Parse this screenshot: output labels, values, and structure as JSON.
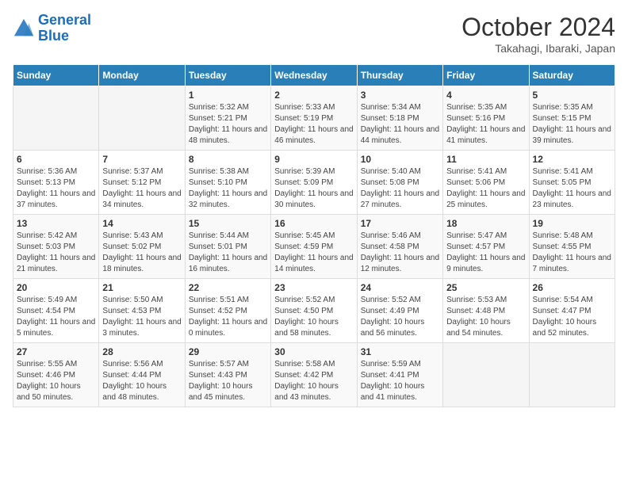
{
  "header": {
    "logo_line1": "General",
    "logo_line2": "Blue",
    "title": "October 2024",
    "subtitle": "Takahagi, Ibaraki, Japan"
  },
  "days_of_week": [
    "Sunday",
    "Monday",
    "Tuesday",
    "Wednesday",
    "Thursday",
    "Friday",
    "Saturday"
  ],
  "weeks": [
    [
      {
        "day": "",
        "sunrise": "",
        "sunset": "",
        "daylight": ""
      },
      {
        "day": "",
        "sunrise": "",
        "sunset": "",
        "daylight": ""
      },
      {
        "day": "1",
        "sunrise": "Sunrise: 5:32 AM",
        "sunset": "Sunset: 5:21 PM",
        "daylight": "Daylight: 11 hours and 48 minutes."
      },
      {
        "day": "2",
        "sunrise": "Sunrise: 5:33 AM",
        "sunset": "Sunset: 5:19 PM",
        "daylight": "Daylight: 11 hours and 46 minutes."
      },
      {
        "day": "3",
        "sunrise": "Sunrise: 5:34 AM",
        "sunset": "Sunset: 5:18 PM",
        "daylight": "Daylight: 11 hours and 44 minutes."
      },
      {
        "day": "4",
        "sunrise": "Sunrise: 5:35 AM",
        "sunset": "Sunset: 5:16 PM",
        "daylight": "Daylight: 11 hours and 41 minutes."
      },
      {
        "day": "5",
        "sunrise": "Sunrise: 5:35 AM",
        "sunset": "Sunset: 5:15 PM",
        "daylight": "Daylight: 11 hours and 39 minutes."
      }
    ],
    [
      {
        "day": "6",
        "sunrise": "Sunrise: 5:36 AM",
        "sunset": "Sunset: 5:13 PM",
        "daylight": "Daylight: 11 hours and 37 minutes."
      },
      {
        "day": "7",
        "sunrise": "Sunrise: 5:37 AM",
        "sunset": "Sunset: 5:12 PM",
        "daylight": "Daylight: 11 hours and 34 minutes."
      },
      {
        "day": "8",
        "sunrise": "Sunrise: 5:38 AM",
        "sunset": "Sunset: 5:10 PM",
        "daylight": "Daylight: 11 hours and 32 minutes."
      },
      {
        "day": "9",
        "sunrise": "Sunrise: 5:39 AM",
        "sunset": "Sunset: 5:09 PM",
        "daylight": "Daylight: 11 hours and 30 minutes."
      },
      {
        "day": "10",
        "sunrise": "Sunrise: 5:40 AM",
        "sunset": "Sunset: 5:08 PM",
        "daylight": "Daylight: 11 hours and 27 minutes."
      },
      {
        "day": "11",
        "sunrise": "Sunrise: 5:41 AM",
        "sunset": "Sunset: 5:06 PM",
        "daylight": "Daylight: 11 hours and 25 minutes."
      },
      {
        "day": "12",
        "sunrise": "Sunrise: 5:41 AM",
        "sunset": "Sunset: 5:05 PM",
        "daylight": "Daylight: 11 hours and 23 minutes."
      }
    ],
    [
      {
        "day": "13",
        "sunrise": "Sunrise: 5:42 AM",
        "sunset": "Sunset: 5:03 PM",
        "daylight": "Daylight: 11 hours and 21 minutes."
      },
      {
        "day": "14",
        "sunrise": "Sunrise: 5:43 AM",
        "sunset": "Sunset: 5:02 PM",
        "daylight": "Daylight: 11 hours and 18 minutes."
      },
      {
        "day": "15",
        "sunrise": "Sunrise: 5:44 AM",
        "sunset": "Sunset: 5:01 PM",
        "daylight": "Daylight: 11 hours and 16 minutes."
      },
      {
        "day": "16",
        "sunrise": "Sunrise: 5:45 AM",
        "sunset": "Sunset: 4:59 PM",
        "daylight": "Daylight: 11 hours and 14 minutes."
      },
      {
        "day": "17",
        "sunrise": "Sunrise: 5:46 AM",
        "sunset": "Sunset: 4:58 PM",
        "daylight": "Daylight: 11 hours and 12 minutes."
      },
      {
        "day": "18",
        "sunrise": "Sunrise: 5:47 AM",
        "sunset": "Sunset: 4:57 PM",
        "daylight": "Daylight: 11 hours and 9 minutes."
      },
      {
        "day": "19",
        "sunrise": "Sunrise: 5:48 AM",
        "sunset": "Sunset: 4:55 PM",
        "daylight": "Daylight: 11 hours and 7 minutes."
      }
    ],
    [
      {
        "day": "20",
        "sunrise": "Sunrise: 5:49 AM",
        "sunset": "Sunset: 4:54 PM",
        "daylight": "Daylight: 11 hours and 5 minutes."
      },
      {
        "day": "21",
        "sunrise": "Sunrise: 5:50 AM",
        "sunset": "Sunset: 4:53 PM",
        "daylight": "Daylight: 11 hours and 3 minutes."
      },
      {
        "day": "22",
        "sunrise": "Sunrise: 5:51 AM",
        "sunset": "Sunset: 4:52 PM",
        "daylight": "Daylight: 11 hours and 0 minutes."
      },
      {
        "day": "23",
        "sunrise": "Sunrise: 5:52 AM",
        "sunset": "Sunset: 4:50 PM",
        "daylight": "Daylight: 10 hours and 58 minutes."
      },
      {
        "day": "24",
        "sunrise": "Sunrise: 5:52 AM",
        "sunset": "Sunset: 4:49 PM",
        "daylight": "Daylight: 10 hours and 56 minutes."
      },
      {
        "day": "25",
        "sunrise": "Sunrise: 5:53 AM",
        "sunset": "Sunset: 4:48 PM",
        "daylight": "Daylight: 10 hours and 54 minutes."
      },
      {
        "day": "26",
        "sunrise": "Sunrise: 5:54 AM",
        "sunset": "Sunset: 4:47 PM",
        "daylight": "Daylight: 10 hours and 52 minutes."
      }
    ],
    [
      {
        "day": "27",
        "sunrise": "Sunrise: 5:55 AM",
        "sunset": "Sunset: 4:46 PM",
        "daylight": "Daylight: 10 hours and 50 minutes."
      },
      {
        "day": "28",
        "sunrise": "Sunrise: 5:56 AM",
        "sunset": "Sunset: 4:44 PM",
        "daylight": "Daylight: 10 hours and 48 minutes."
      },
      {
        "day": "29",
        "sunrise": "Sunrise: 5:57 AM",
        "sunset": "Sunset: 4:43 PM",
        "daylight": "Daylight: 10 hours and 45 minutes."
      },
      {
        "day": "30",
        "sunrise": "Sunrise: 5:58 AM",
        "sunset": "Sunset: 4:42 PM",
        "daylight": "Daylight: 10 hours and 43 minutes."
      },
      {
        "day": "31",
        "sunrise": "Sunrise: 5:59 AM",
        "sunset": "Sunset: 4:41 PM",
        "daylight": "Daylight: 10 hours and 41 minutes."
      },
      {
        "day": "",
        "sunrise": "",
        "sunset": "",
        "daylight": ""
      },
      {
        "day": "",
        "sunrise": "",
        "sunset": "",
        "daylight": ""
      }
    ]
  ]
}
